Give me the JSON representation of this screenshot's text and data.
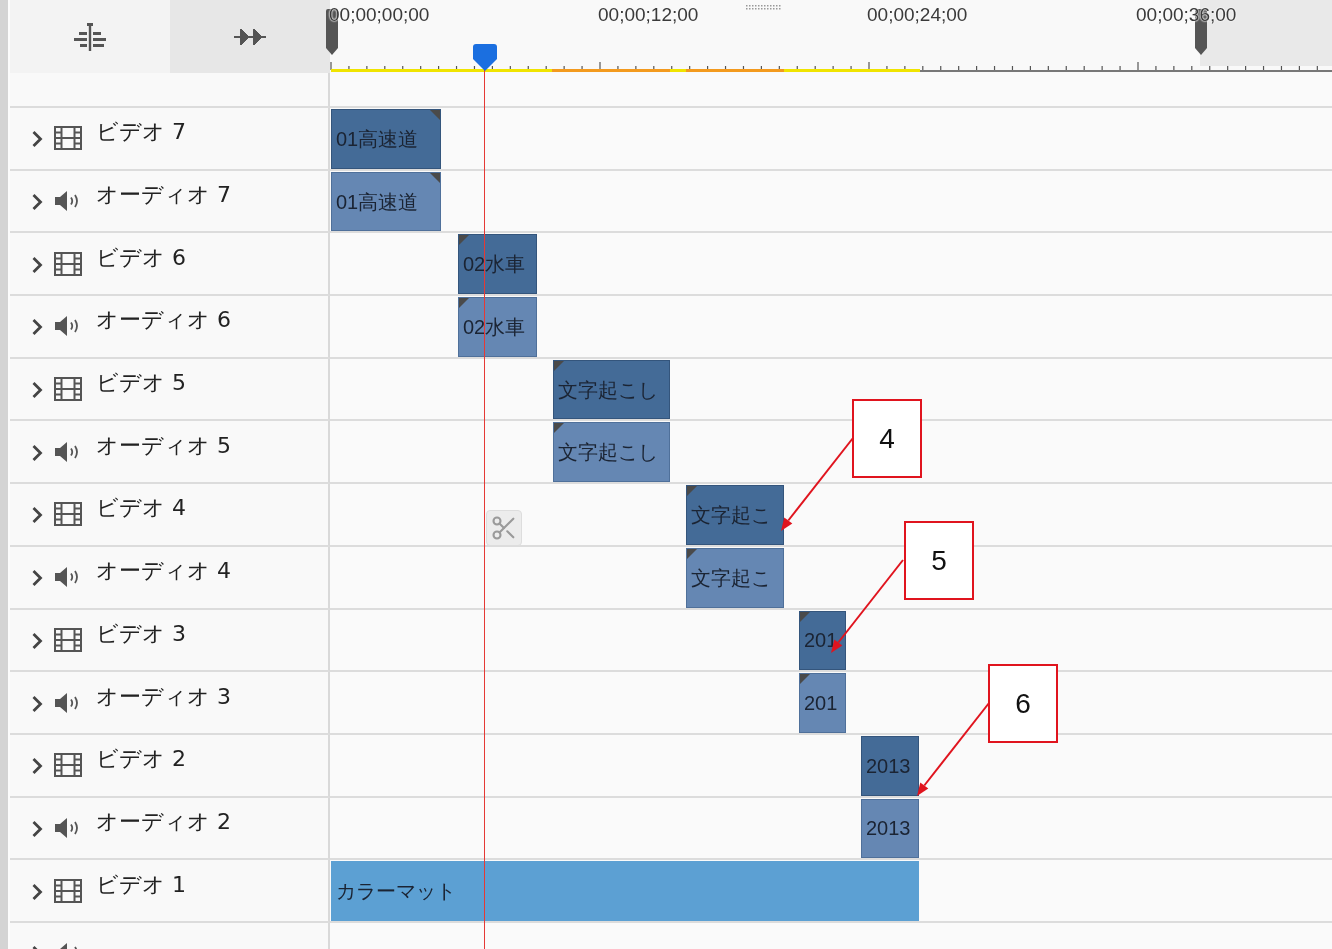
{
  "toolbar": {
    "buttons": [
      {
        "kind": "snap",
        "active": false
      },
      {
        "kind": "ripple",
        "active": true
      }
    ]
  },
  "ruler": {
    "timecodes": [
      "00;00;00;00",
      "00;00;12;00",
      "00;00;24;00",
      "00;00;36;00"
    ]
  },
  "tracks": [
    {
      "kind": "video",
      "name": "ビデオ 7",
      "expanded": false,
      "clips": [
        {
          "kind": "media",
          "label": "01高速道",
          "left_corner_mark": false,
          "right_corner_mark": true
        }
      ]
    },
    {
      "kind": "audio",
      "name": "オーディオ 7",
      "expanded": false,
      "clips": [
        {
          "kind": "media",
          "label": "01高速道",
          "left_corner_mark": false,
          "right_corner_mark": true
        }
      ]
    },
    {
      "kind": "video",
      "name": "ビデオ 6",
      "expanded": false,
      "clips": [
        {
          "kind": "media",
          "label": "02水車",
          "left_corner_mark": true,
          "right_corner_mark": false
        }
      ]
    },
    {
      "kind": "audio",
      "name": "オーディオ 6",
      "expanded": false,
      "clips": [
        {
          "kind": "media",
          "label": "02水車",
          "left_corner_mark": true,
          "right_corner_mark": false
        }
      ]
    },
    {
      "kind": "video",
      "name": "ビデオ 5",
      "expanded": false,
      "clips": [
        {
          "kind": "media",
          "label": "文字起こし",
          "left_corner_mark": true,
          "right_corner_mark": false
        }
      ]
    },
    {
      "kind": "audio",
      "name": "オーディオ 5",
      "expanded": false,
      "clips": [
        {
          "kind": "media",
          "label": "文字起こし",
          "left_corner_mark": true,
          "right_corner_mark": false
        }
      ]
    },
    {
      "kind": "video",
      "name": "ビデオ 4",
      "expanded": false,
      "clips": [
        {
          "kind": "media",
          "label": "文字起こ",
          "left_corner_mark": true,
          "right_corner_mark": false
        }
      ]
    },
    {
      "kind": "audio",
      "name": "オーディオ 4",
      "expanded": false,
      "clips": [
        {
          "kind": "media",
          "label": "文字起こ",
          "left_corner_mark": true,
          "right_corner_mark": false
        }
      ]
    },
    {
      "kind": "video",
      "name": "ビデオ 3",
      "expanded": false,
      "clips": [
        {
          "kind": "media",
          "label": "201",
          "left_corner_mark": true,
          "right_corner_mark": false
        }
      ]
    },
    {
      "kind": "audio",
      "name": "オーディオ 3",
      "expanded": false,
      "clips": [
        {
          "kind": "media",
          "label": "201",
          "left_corner_mark": true,
          "right_corner_mark": false
        }
      ]
    },
    {
      "kind": "video",
      "name": "ビデオ 2",
      "expanded": false,
      "clips": [
        {
          "kind": "media",
          "label": "2013",
          "left_corner_mark": false,
          "right_corner_mark": false
        }
      ]
    },
    {
      "kind": "audio",
      "name": "オーディオ 2",
      "expanded": false,
      "clips": [
        {
          "kind": "media",
          "label": "2013",
          "left_corner_mark": false,
          "right_corner_mark": false
        }
      ]
    },
    {
      "kind": "video",
      "name": "ビデオ 1",
      "expanded": false,
      "clips": [
        {
          "kind": "color_matte",
          "label": "カラーマット",
          "left_corner_mark": false,
          "right_corner_mark": false
        }
      ]
    },
    {
      "kind": "audio",
      "expanded": false
    }
  ],
  "callouts": [
    {
      "number": "4"
    },
    {
      "number": "5"
    },
    {
      "number": "6"
    }
  ]
}
